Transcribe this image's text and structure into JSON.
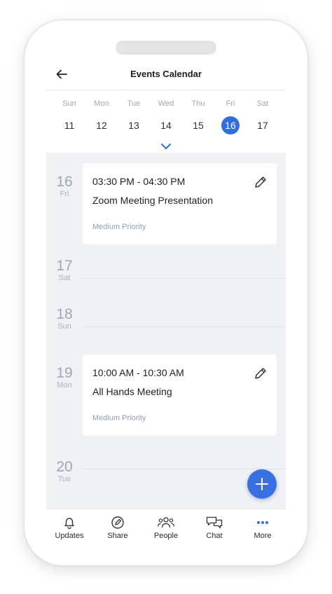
{
  "header": {
    "title": "Events Calendar",
    "back_icon": "arrow-left-icon"
  },
  "week": {
    "days": [
      {
        "name": "Sun",
        "date": "11",
        "selected": false
      },
      {
        "name": "Mon",
        "date": "12",
        "selected": false
      },
      {
        "name": "Tue",
        "date": "13",
        "selected": false
      },
      {
        "name": "Wed",
        "date": "14",
        "selected": false
      },
      {
        "name": "Thu",
        "date": "15",
        "selected": false
      },
      {
        "name": "Fri",
        "date": "16",
        "selected": true
      },
      {
        "name": "Sat",
        "date": "17",
        "selected": false
      }
    ],
    "expand_icon": "chevron-down-icon"
  },
  "agenda": {
    "days": [
      {
        "num": "16",
        "weekday": "Fri"
      },
      {
        "num": "17",
        "weekday": "Sat"
      },
      {
        "num": "18",
        "weekday": "Sun"
      },
      {
        "num": "19",
        "weekday": "Mon"
      },
      {
        "num": "20",
        "weekday": "Tue"
      }
    ],
    "events": [
      {
        "time": "03:30 PM - 04:30 PM",
        "title": "Zoom Meeting Presentation",
        "priority": "Medium Priority"
      },
      {
        "time": "10:00 AM - 10:30 AM",
        "title": "All Hands Meeting",
        "priority": "Medium Priority"
      }
    ]
  },
  "fab": {
    "icon": "plus-icon"
  },
  "nav": {
    "items": [
      {
        "label": "Updates",
        "icon": "bell-icon"
      },
      {
        "label": "Share",
        "icon": "share-edit-icon"
      },
      {
        "label": "People",
        "icon": "people-icon"
      },
      {
        "label": "Chat",
        "icon": "chat-icon"
      },
      {
        "label": "More",
        "icon": "more-dots-icon"
      }
    ]
  },
  "colors": {
    "accent": "#2f6fe0",
    "agenda_bg": "#eff1f4",
    "muted": "#9aa8b7"
  }
}
